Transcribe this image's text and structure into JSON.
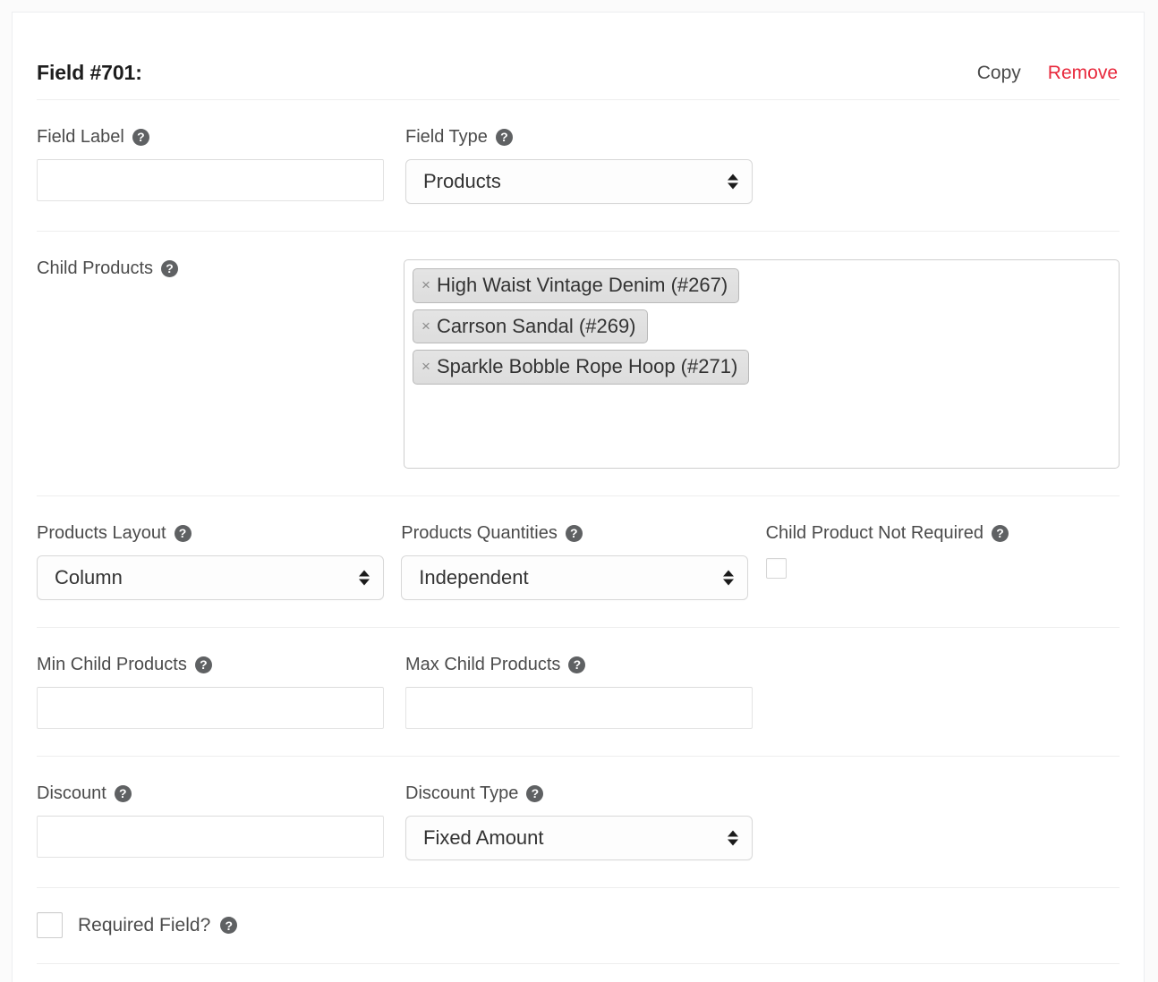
{
  "card": {
    "title": "Field #701:",
    "actions": [
      {
        "label": "Copy",
        "name": "copy-button"
      },
      {
        "label": "Remove",
        "name": "remove-button"
      }
    ],
    "accent_remove_color": "#e8283c"
  },
  "fields": {
    "field_label": {
      "label": "Field Label",
      "help": "?",
      "value": "",
      "placeholder": ""
    },
    "field_type": {
      "label": "Field Type",
      "help": "?",
      "value": "Products"
    },
    "child_products": {
      "label": "Child Products",
      "help": "?",
      "tags": [
        {
          "remove": "×",
          "label": "High Waist Vintage Denim (#267)"
        },
        {
          "remove": "×",
          "label": "Carrson Sandal (#269)"
        },
        {
          "remove": "×",
          "label": "Sparkle Bobble Rope Hoop (#271)"
        }
      ]
    },
    "products_layout": {
      "label": "Products Layout",
      "help": "?",
      "value": "Column"
    },
    "products_quantities": {
      "label": "Products Quantities",
      "help": "?",
      "value": "Independent"
    },
    "child_product_not_required": {
      "label": "Child Product Not Required",
      "help": "?",
      "checked": false
    },
    "min_child_products": {
      "label": "Min Child Products",
      "help": "?",
      "value": "",
      "placeholder": ""
    },
    "max_child_products": {
      "label": "Max Child Products",
      "help": "?",
      "value": "",
      "placeholder": ""
    },
    "discount": {
      "label": "Discount",
      "help": "?",
      "value": "",
      "placeholder": ""
    },
    "discount_type": {
      "label": "Discount Type",
      "help": "?",
      "value": "Fixed Amount"
    },
    "required_field": {
      "label": "Required Field?",
      "help": "?",
      "checked": false
    }
  }
}
